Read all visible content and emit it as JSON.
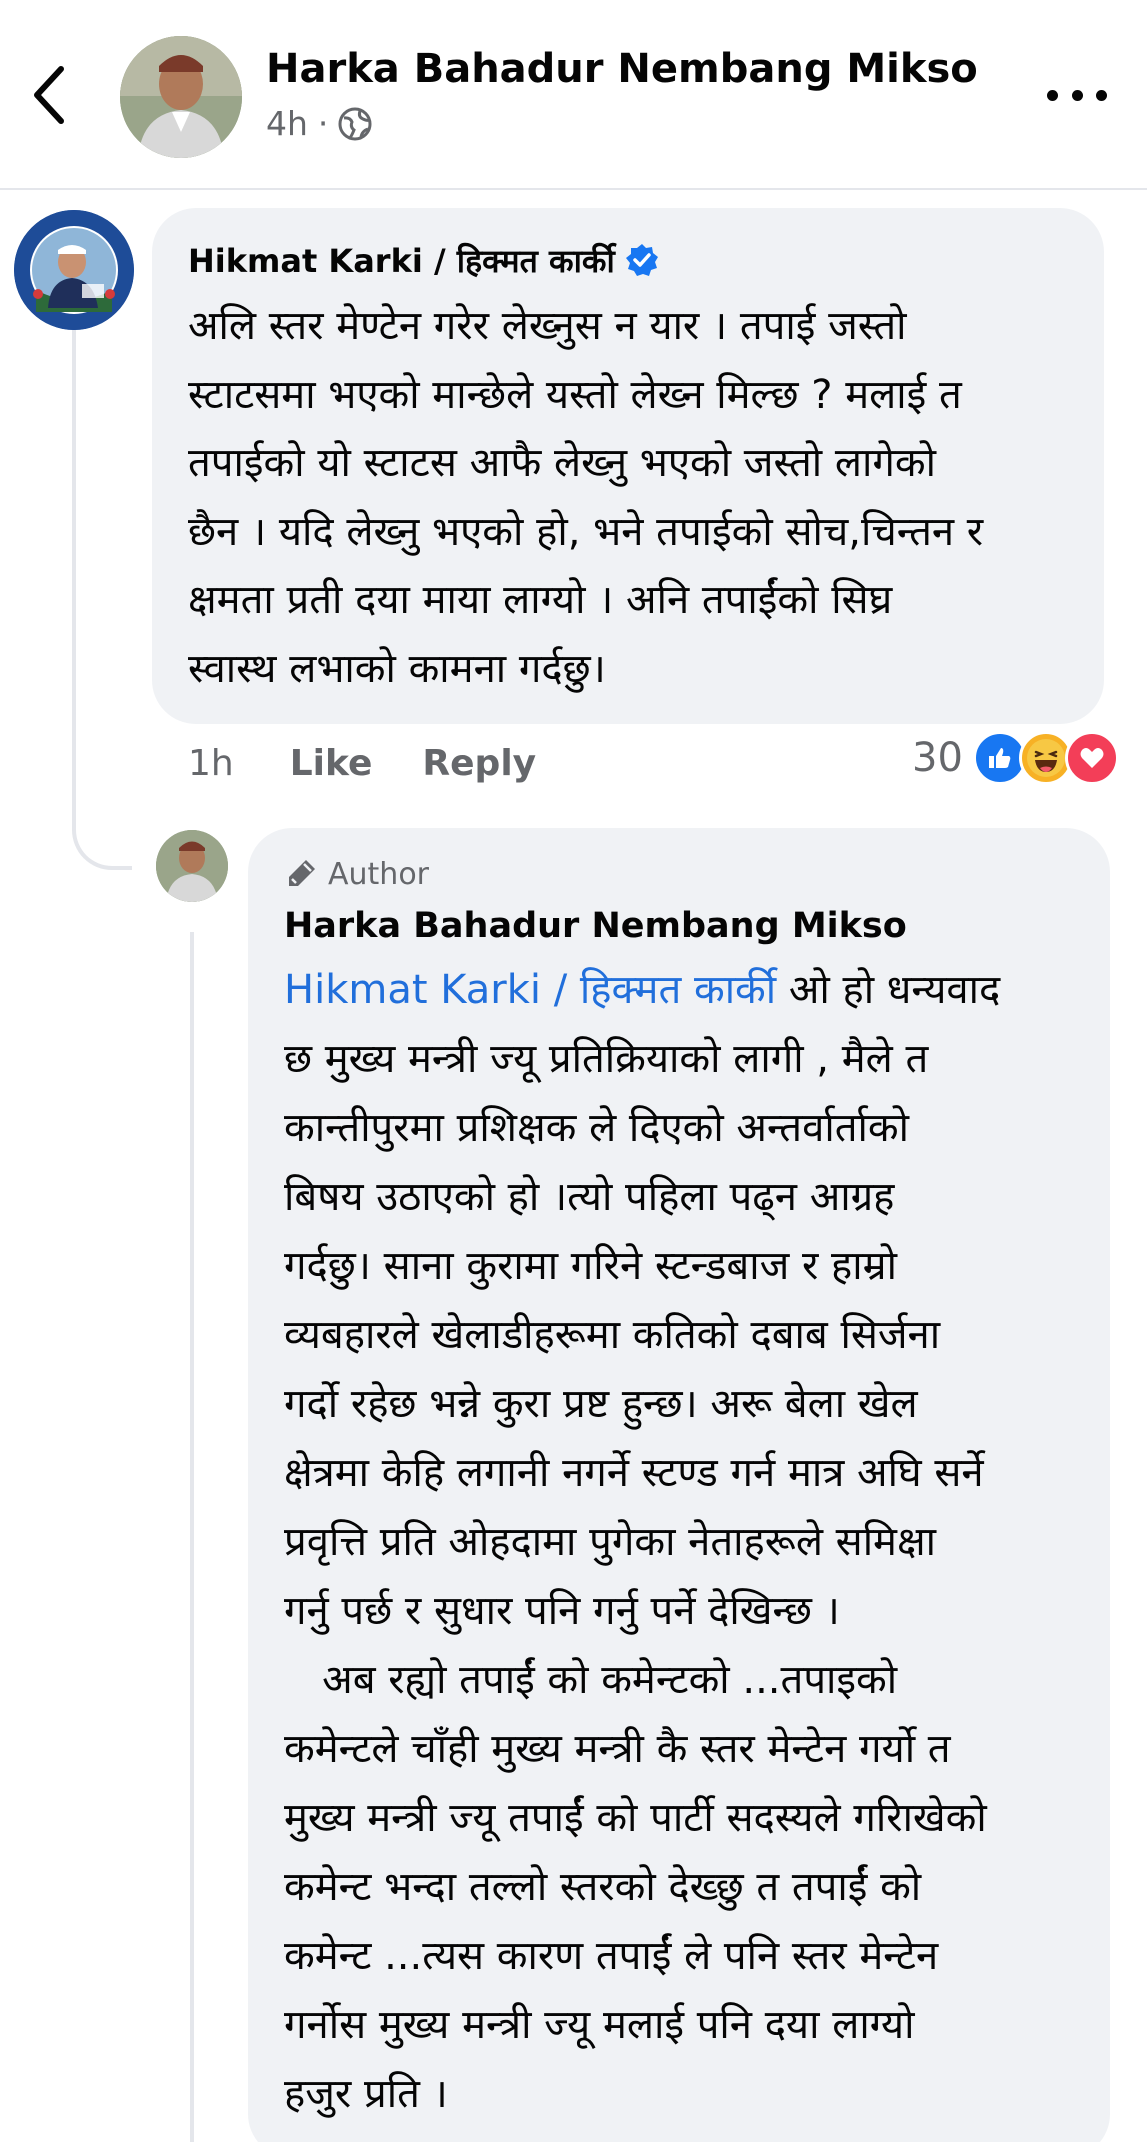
{
  "header": {
    "author_name": "Harka Bahadur Nembang Mikso",
    "time": "4h",
    "separator": "·",
    "privacy_icon": "globe-icon"
  },
  "comment": {
    "author": "Hikmat Karki / हिक्मत कार्की",
    "verified_icon": "verified-badge-icon",
    "text": "अलि स्तर मेण्टेन गरेर लेख्नुस न यार । तपाई जस्तो\nस्टाटसमा भएको मान्छेले यस्तो लेख्न मिल्छ ? मलाई त\nतपाईको यो स्टाटस आफै लेख्नु भएको जस्तो लागेको\nछैन । यदि लेख्नु भएको हो, भने तपाईको सोच,चिन्तन र\nक्षमता प्रती दया माया लाग्यो । अनि तपाईंको सिघ्र\nस्वास्थ लभाको कामना गर्दछु।",
    "time": "1h",
    "like_label": "Like",
    "reply_label": "Reply",
    "reaction_count": "30",
    "reactions": [
      "like",
      "haha",
      "love"
    ],
    "colors": {
      "like": "#1877f2",
      "haha": "#f7b125",
      "love": "#f33e58"
    }
  },
  "reply": {
    "badge": "Author",
    "author": "Harka Bahadur Nembang Mikso",
    "mention": "Hikmat Karki / हिक्मत कार्की",
    "text": " ओ हो धन्यवाद\nछ मुख्य मन्त्री ज्यू प्रतिक्रियाको लागी , मैले त\nकान्तीपुरमा प्रशिक्षक ले दिएको अन्तर्वार्ताको\nबिषय उठाएको हो ।त्यो पहिला पढ्न आग्रह\nगर्दछु। साना कुरामा गरिने स्टन्डबाज र हाम्रो\nव्यबहारले खेलाडीहरूमा कतिको दबाब सिर्जना\nगर्दो रहेछ भन्ने कुरा प्रष्ट हुन्छ। अरू बेला खेल\nक्षेत्रमा केहि लगानी नगर्ने स्टण्ड गर्न मात्र अघि सर्ने\nप्रवृत्ति प्रति ओहदामा पुगेका नेताहरूले समिक्षा\nगर्नु पर्छ र सुधार पनि गर्नु पर्ने देखिन्छ ।\n   अब रह्यो तपाईं को कमेन्टको ...तपाइको\nकमेन्टले चाँही मुख्य मन्त्री कै स्तर मेन्टेन गर्यो त\nमुख्य मन्त्री ज्यू तपाईं को पार्टी सदस्यले गरिाखेको\nकमेन्ट भन्दा तल्लो स्तरको देख्छु त तपाईं को\nकमेन्ट ...त्यस कारण तपाईं ले पनि स्तर मेन्टेन\nगर्नोस मुख्य मन्त्री ज्यू मलाई पनि दया लाग्यो\nहजुर प्रति ।"
  }
}
